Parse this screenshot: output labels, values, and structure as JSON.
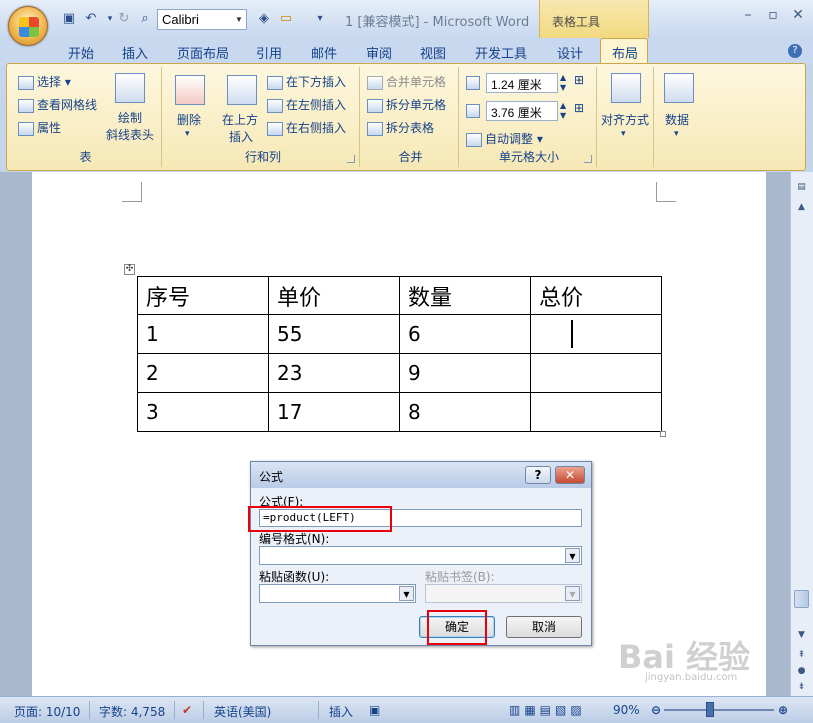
{
  "titlebar": {
    "font_name": "Calibri",
    "doc_title": "1 [兼容模式] - Microsoft Word",
    "contextual_tab": "表格工具"
  },
  "tabs": [
    "开始",
    "插入",
    "页面布局",
    "引用",
    "邮件",
    "审阅",
    "视图",
    "开发工具",
    "设计",
    "布局"
  ],
  "active_tab": "布局",
  "ribbon": {
    "table_group": {
      "label": "表",
      "select": "选择",
      "view_gridlines": "查看网格线",
      "properties": "属性",
      "draw_diagonal_1": "绘制",
      "draw_diagonal_2": "斜线表头"
    },
    "rows_cols_group": {
      "label": "行和列",
      "delete": "删除",
      "insert_above_1": "在上方",
      "insert_above_2": "插入",
      "insert_below": "在下方插入",
      "insert_left": "在左侧插入",
      "insert_right": "在右侧插入"
    },
    "merge_group": {
      "label": "合并",
      "merge_cells": "合并单元格",
      "split_cells": "拆分单元格",
      "split_table": "拆分表格"
    },
    "cell_size_group": {
      "label": "单元格大小",
      "height": "1.24 厘米",
      "width": "3.76 厘米",
      "autofit": "自动调整"
    },
    "alignment": "对齐方式",
    "data": "数据"
  },
  "table": {
    "headers": [
      "序号",
      "单价",
      "数量",
      "总价"
    ],
    "rows": [
      [
        "1",
        "55",
        "6",
        ""
      ],
      [
        "2",
        "23",
        "9",
        ""
      ],
      [
        "3",
        "17",
        "8",
        ""
      ]
    ]
  },
  "dialog": {
    "title": "公式",
    "formula_label": "公式(F):",
    "formula_value": "=product(LEFT)",
    "number_format_label": "编号格式(N):",
    "paste_function_label": "粘贴函数(U):",
    "paste_bookmark_label": "粘贴书签(B):",
    "ok": "确定",
    "cancel": "取消"
  },
  "statusbar": {
    "page": "页面: 10/10",
    "words": "字数: 4,758",
    "language": "英语(美国)",
    "mode": "插入",
    "zoom": "90%"
  },
  "watermark": "Bai 经验",
  "watermark_sub": "jingyan.baidu.com"
}
